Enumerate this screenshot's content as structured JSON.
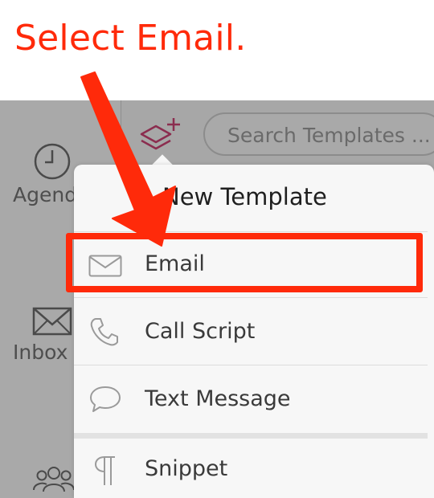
{
  "instruction": "Select Email.",
  "sidebar": {
    "items": [
      {
        "label": "Agenda",
        "icon": "clock-icon"
      },
      {
        "label": "Inbox",
        "icon": "envelope-icon"
      },
      {
        "label": "",
        "icon": "people-icon"
      }
    ]
  },
  "toolbar": {
    "new_template_icon": "layers-plus-icon"
  },
  "search": {
    "placeholder": "Search Templates ..."
  },
  "popup": {
    "title": "New Template",
    "items": [
      {
        "label": "Email",
        "icon": "envelope-icon"
      },
      {
        "label": "Call Script",
        "icon": "phone-icon"
      },
      {
        "label": "Text Message",
        "icon": "chat-bubble-icon"
      },
      {
        "label": "Snippet",
        "icon": "pilcrow-icon"
      }
    ]
  },
  "colors": {
    "annotation": "#ff2a0a",
    "app_background": "#a9a9a9",
    "popup_background": "#f7f7f7",
    "accent_icon": "#8b2d4f"
  }
}
